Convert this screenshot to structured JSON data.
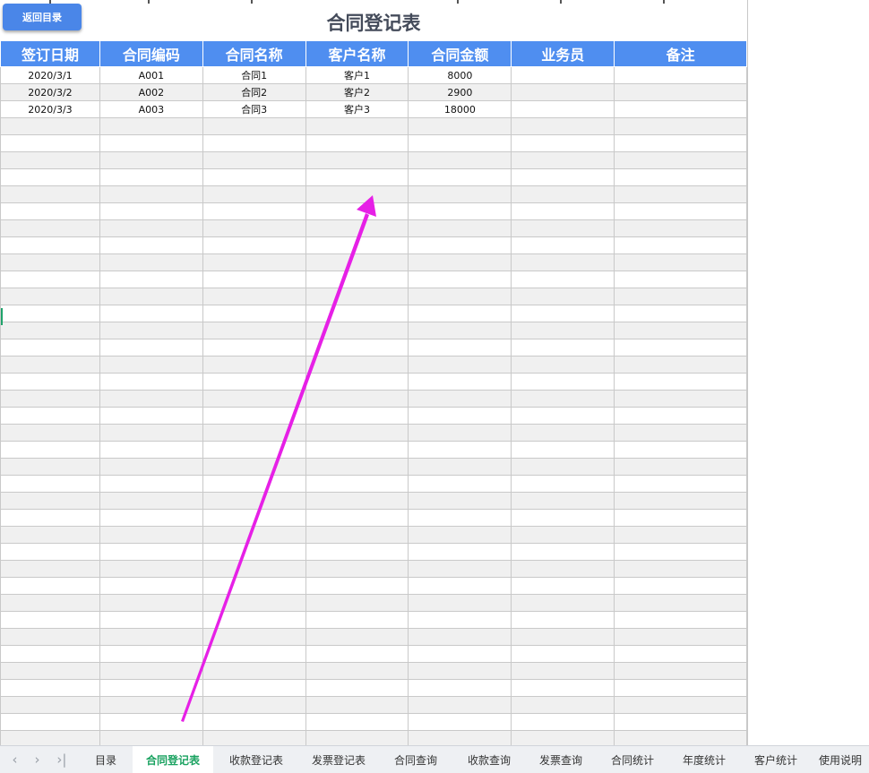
{
  "header": {
    "title": "合同登记表",
    "back_button": "返回目录"
  },
  "table": {
    "columns": [
      "签订日期",
      "合同编码",
      "合同名称",
      "客户名称",
      "合同金额",
      "业务员",
      "备注"
    ],
    "rows": [
      [
        "2020/3/1",
        "A001",
        "合同1",
        "客户1",
        "8000",
        "",
        ""
      ],
      [
        "2020/3/2",
        "A002",
        "合同2",
        "客户2",
        "2900",
        "",
        ""
      ],
      [
        "2020/3/3",
        "A003",
        "合同3",
        "客户3",
        "18000",
        "",
        ""
      ]
    ],
    "empty_row_count": 37
  },
  "sheet_tabs": {
    "nav_icons": [
      "chevron-left-icon",
      "chevron-right-icon",
      "skip-to-last-icon"
    ],
    "tabs": [
      "目录",
      "合同登记表",
      "收款登记表",
      "发票登记表",
      "合同查询",
      "收款查询",
      "发票查询",
      "合同统计",
      "年度统计",
      "客户统计",
      "使用说明"
    ],
    "active": "合同登记表"
  },
  "colors": {
    "header_bg": "#4f8ef0",
    "button_bg": "#4a86e8",
    "annotation_arrow": "#e620e6",
    "active_tab_text": "#1aa260"
  }
}
